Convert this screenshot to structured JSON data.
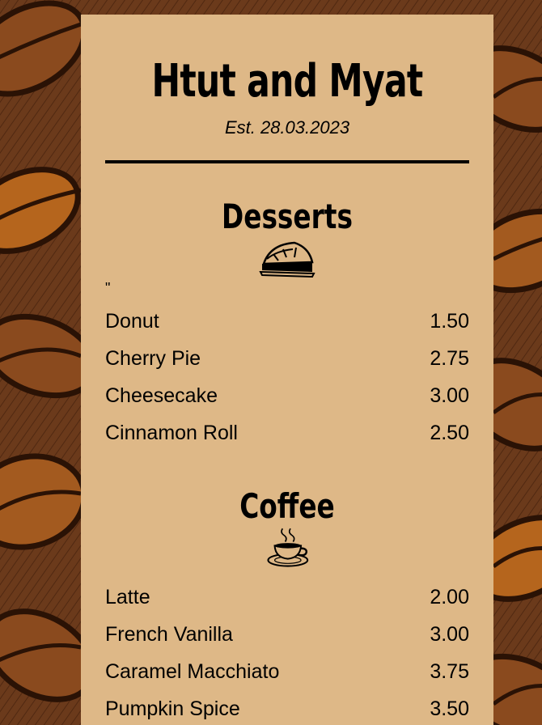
{
  "restaurant": {
    "name": "Htut and Myat",
    "established": "Est. 28.03.2023"
  },
  "stray_text": "\"",
  "sections": [
    {
      "title": "Desserts",
      "icon": "pie-slice-icon",
      "items": [
        {
          "name": "Donut",
          "price": "1.50"
        },
        {
          "name": "Cherry Pie",
          "price": "2.75"
        },
        {
          "name": "Cheesecake",
          "price": "3.00"
        },
        {
          "name": "Cinnamon Roll",
          "price": "2.50"
        }
      ]
    },
    {
      "title": "Coffee",
      "icon": "coffee-cup-icon",
      "items": [
        {
          "name": "Latte",
          "price": "2.00"
        },
        {
          "name": "French Vanilla",
          "price": "3.00"
        },
        {
          "name": "Caramel Macchiato",
          "price": "3.75"
        },
        {
          "name": "Pumpkin Spice",
          "price": "3.50"
        }
      ]
    }
  ],
  "colors": {
    "background": "#6b3a1b",
    "menu_panel": "#deb887",
    "text": "#000000"
  }
}
